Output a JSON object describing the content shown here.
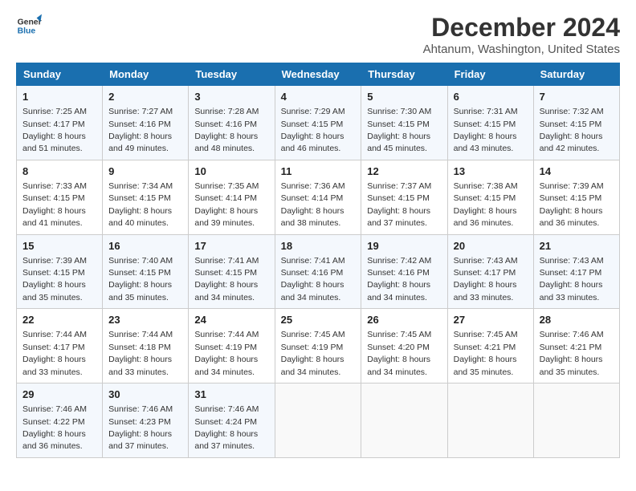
{
  "header": {
    "logo_line1": "General",
    "logo_line2": "Blue",
    "month": "December 2024",
    "location": "Ahtanum, Washington, United States"
  },
  "weekdays": [
    "Sunday",
    "Monday",
    "Tuesday",
    "Wednesday",
    "Thursday",
    "Friday",
    "Saturday"
  ],
  "weeks": [
    [
      {
        "day": "1",
        "sunrise": "Sunrise: 7:25 AM",
        "sunset": "Sunset: 4:17 PM",
        "daylight": "Daylight: 8 hours and 51 minutes."
      },
      {
        "day": "2",
        "sunrise": "Sunrise: 7:27 AM",
        "sunset": "Sunset: 4:16 PM",
        "daylight": "Daylight: 8 hours and 49 minutes."
      },
      {
        "day": "3",
        "sunrise": "Sunrise: 7:28 AM",
        "sunset": "Sunset: 4:16 PM",
        "daylight": "Daylight: 8 hours and 48 minutes."
      },
      {
        "day": "4",
        "sunrise": "Sunrise: 7:29 AM",
        "sunset": "Sunset: 4:15 PM",
        "daylight": "Daylight: 8 hours and 46 minutes."
      },
      {
        "day": "5",
        "sunrise": "Sunrise: 7:30 AM",
        "sunset": "Sunset: 4:15 PM",
        "daylight": "Daylight: 8 hours and 45 minutes."
      },
      {
        "day": "6",
        "sunrise": "Sunrise: 7:31 AM",
        "sunset": "Sunset: 4:15 PM",
        "daylight": "Daylight: 8 hours and 43 minutes."
      },
      {
        "day": "7",
        "sunrise": "Sunrise: 7:32 AM",
        "sunset": "Sunset: 4:15 PM",
        "daylight": "Daylight: 8 hours and 42 minutes."
      }
    ],
    [
      {
        "day": "8",
        "sunrise": "Sunrise: 7:33 AM",
        "sunset": "Sunset: 4:15 PM",
        "daylight": "Daylight: 8 hours and 41 minutes."
      },
      {
        "day": "9",
        "sunrise": "Sunrise: 7:34 AM",
        "sunset": "Sunset: 4:15 PM",
        "daylight": "Daylight: 8 hours and 40 minutes."
      },
      {
        "day": "10",
        "sunrise": "Sunrise: 7:35 AM",
        "sunset": "Sunset: 4:14 PM",
        "daylight": "Daylight: 8 hours and 39 minutes."
      },
      {
        "day": "11",
        "sunrise": "Sunrise: 7:36 AM",
        "sunset": "Sunset: 4:14 PM",
        "daylight": "Daylight: 8 hours and 38 minutes."
      },
      {
        "day": "12",
        "sunrise": "Sunrise: 7:37 AM",
        "sunset": "Sunset: 4:15 PM",
        "daylight": "Daylight: 8 hours and 37 minutes."
      },
      {
        "day": "13",
        "sunrise": "Sunrise: 7:38 AM",
        "sunset": "Sunset: 4:15 PM",
        "daylight": "Daylight: 8 hours and 36 minutes."
      },
      {
        "day": "14",
        "sunrise": "Sunrise: 7:39 AM",
        "sunset": "Sunset: 4:15 PM",
        "daylight": "Daylight: 8 hours and 36 minutes."
      }
    ],
    [
      {
        "day": "15",
        "sunrise": "Sunrise: 7:39 AM",
        "sunset": "Sunset: 4:15 PM",
        "daylight": "Daylight: 8 hours and 35 minutes."
      },
      {
        "day": "16",
        "sunrise": "Sunrise: 7:40 AM",
        "sunset": "Sunset: 4:15 PM",
        "daylight": "Daylight: 8 hours and 35 minutes."
      },
      {
        "day": "17",
        "sunrise": "Sunrise: 7:41 AM",
        "sunset": "Sunset: 4:15 PM",
        "daylight": "Daylight: 8 hours and 34 minutes."
      },
      {
        "day": "18",
        "sunrise": "Sunrise: 7:41 AM",
        "sunset": "Sunset: 4:16 PM",
        "daylight": "Daylight: 8 hours and 34 minutes."
      },
      {
        "day": "19",
        "sunrise": "Sunrise: 7:42 AM",
        "sunset": "Sunset: 4:16 PM",
        "daylight": "Daylight: 8 hours and 34 minutes."
      },
      {
        "day": "20",
        "sunrise": "Sunrise: 7:43 AM",
        "sunset": "Sunset: 4:17 PM",
        "daylight": "Daylight: 8 hours and 33 minutes."
      },
      {
        "day": "21",
        "sunrise": "Sunrise: 7:43 AM",
        "sunset": "Sunset: 4:17 PM",
        "daylight": "Daylight: 8 hours and 33 minutes."
      }
    ],
    [
      {
        "day": "22",
        "sunrise": "Sunrise: 7:44 AM",
        "sunset": "Sunset: 4:17 PM",
        "daylight": "Daylight: 8 hours and 33 minutes."
      },
      {
        "day": "23",
        "sunrise": "Sunrise: 7:44 AM",
        "sunset": "Sunset: 4:18 PM",
        "daylight": "Daylight: 8 hours and 33 minutes."
      },
      {
        "day": "24",
        "sunrise": "Sunrise: 7:44 AM",
        "sunset": "Sunset: 4:19 PM",
        "daylight": "Daylight: 8 hours and 34 minutes."
      },
      {
        "day": "25",
        "sunrise": "Sunrise: 7:45 AM",
        "sunset": "Sunset: 4:19 PM",
        "daylight": "Daylight: 8 hours and 34 minutes."
      },
      {
        "day": "26",
        "sunrise": "Sunrise: 7:45 AM",
        "sunset": "Sunset: 4:20 PM",
        "daylight": "Daylight: 8 hours and 34 minutes."
      },
      {
        "day": "27",
        "sunrise": "Sunrise: 7:45 AM",
        "sunset": "Sunset: 4:21 PM",
        "daylight": "Daylight: 8 hours and 35 minutes."
      },
      {
        "day": "28",
        "sunrise": "Sunrise: 7:46 AM",
        "sunset": "Sunset: 4:21 PM",
        "daylight": "Daylight: 8 hours and 35 minutes."
      }
    ],
    [
      {
        "day": "29",
        "sunrise": "Sunrise: 7:46 AM",
        "sunset": "Sunset: 4:22 PM",
        "daylight": "Daylight: 8 hours and 36 minutes."
      },
      {
        "day": "30",
        "sunrise": "Sunrise: 7:46 AM",
        "sunset": "Sunset: 4:23 PM",
        "daylight": "Daylight: 8 hours and 37 minutes."
      },
      {
        "day": "31",
        "sunrise": "Sunrise: 7:46 AM",
        "sunset": "Sunset: 4:24 PM",
        "daylight": "Daylight: 8 hours and 37 minutes."
      },
      null,
      null,
      null,
      null
    ]
  ]
}
